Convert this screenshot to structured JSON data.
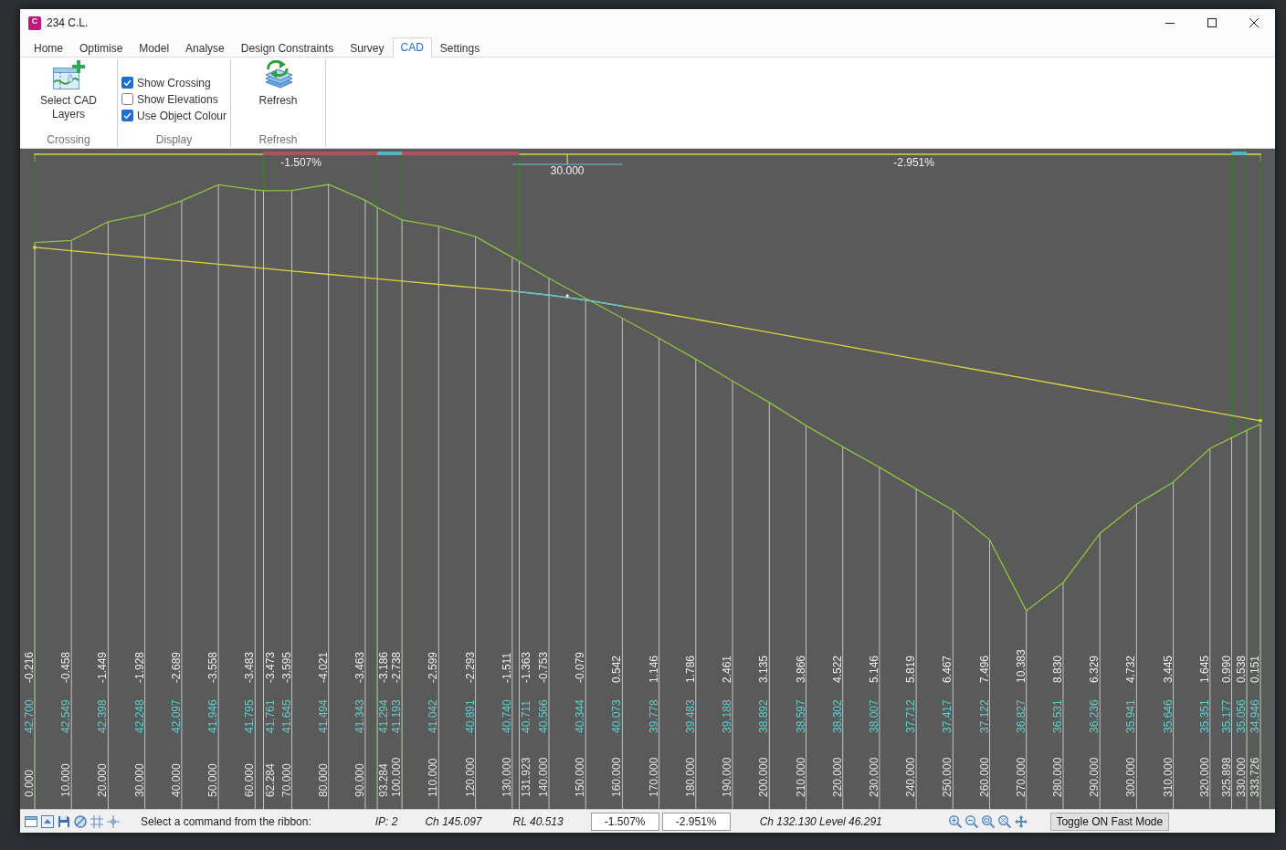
{
  "window": {
    "title": "234 C.L.",
    "logo_letter": "C"
  },
  "ribbon_tabs": [
    {
      "label": "Home",
      "selected": false
    },
    {
      "label": "Optimise",
      "selected": false
    },
    {
      "label": "Model",
      "selected": false
    },
    {
      "label": "Analyse",
      "selected": false
    },
    {
      "label": "Design Constraints",
      "selected": false
    },
    {
      "label": "Survey",
      "selected": false
    },
    {
      "label": "CAD",
      "selected": true
    },
    {
      "label": "Settings",
      "selected": false
    }
  ],
  "ribbon_groups": [
    {
      "kind": "layers",
      "label": "Crossing",
      "button": "Select CAD Layers"
    },
    {
      "kind": "checkboxes",
      "label": "Display",
      "checkboxes": [
        {
          "label": "Show Crossing",
          "checked": true
        },
        {
          "label": "Show Elevations",
          "checked": false
        },
        {
          "label": "Use Object Colour",
          "checked": true
        }
      ]
    },
    {
      "kind": "refresh",
      "label": "Refresh",
      "button": "Refresh"
    }
  ],
  "long_section": {
    "grades": [
      {
        "label": "-1.507%"
      },
      {
        "label": "-2.951%"
      }
    ],
    "vertical_curve": {
      "length": "30.000"
    },
    "alignment_segments": [
      {
        "kind": "plain"
      },
      {
        "kind": "band",
        "color": "#b4505c"
      },
      {
        "kind": "band",
        "color": "#4db8cc"
      },
      {
        "kind": "band",
        "color": "#b4505c"
      },
      {
        "kind": "plain"
      },
      {
        "kind": "band",
        "color": "#4db8cc"
      },
      {
        "kind": "plain"
      }
    ],
    "stations": [
      {
        "kind": "key",
        "chainage": "0.000",
        "level": "42.700",
        "depth": "-0.216"
      },
      {
        "kind": "regular",
        "chainage": "10.000",
        "level": "42.549",
        "depth": "-0.458"
      },
      {
        "kind": "regular",
        "chainage": "20.000",
        "level": "42.398",
        "depth": "-1.449"
      },
      {
        "kind": "regular",
        "chainage": "30.000",
        "level": "42.248",
        "depth": "-1.928"
      },
      {
        "kind": "regular",
        "chainage": "40.000",
        "level": "42.097",
        "depth": "-2.689"
      },
      {
        "kind": "regular",
        "chainage": "50.000",
        "level": "41.946",
        "depth": "-3.558"
      },
      {
        "kind": "regular",
        "chainage": "60.000",
        "level": "41.795",
        "depth": "-3.483"
      },
      {
        "kind": "key",
        "chainage": "62.284",
        "level": "41.761",
        "depth": "-3.473"
      },
      {
        "kind": "regular",
        "chainage": "70.000",
        "level": "41.645",
        "depth": "-3.595"
      },
      {
        "kind": "regular",
        "chainage": "80.000",
        "level": "41.494",
        "depth": "-4.021"
      },
      {
        "kind": "regular",
        "chainage": "90.000",
        "level": "41.343",
        "depth": "-3.463"
      },
      {
        "kind": "key",
        "chainage": "93.284",
        "level": "41.294",
        "depth": "-3.186"
      },
      {
        "kind": "key",
        "chainage": "100.000",
        "level": "41.193",
        "depth": "-2.738"
      },
      {
        "kind": "regular",
        "chainage": "110.000",
        "level": "41.042",
        "depth": "-2.599"
      },
      {
        "kind": "regular",
        "chainage": "120.000",
        "level": "40.891",
        "depth": "-2.293"
      },
      {
        "kind": "regular",
        "chainage": "130.000",
        "level": "40.740",
        "depth": "-1.511"
      },
      {
        "kind": "key",
        "chainage": "131.923",
        "level": "40.711",
        "depth": "-1.363"
      },
      {
        "kind": "regular",
        "chainage": "140.000",
        "level": "40.566",
        "depth": "-0.753"
      },
      {
        "kind": "regular",
        "chainage": "150.000",
        "level": "40.344",
        "depth": "-0.079"
      },
      {
        "kind": "regular",
        "chainage": "160.000",
        "level": "40.073",
        "depth": "0.542"
      },
      {
        "kind": "regular",
        "chainage": "170.000",
        "level": "39.778",
        "depth": "1.146"
      },
      {
        "kind": "regular",
        "chainage": "180.000",
        "level": "39.483",
        "depth": "1.786"
      },
      {
        "kind": "regular",
        "chainage": "190.000",
        "level": "39.188",
        "depth": "2.461"
      },
      {
        "kind": "regular",
        "chainage": "200.000",
        "level": "38.892",
        "depth": "3.135"
      },
      {
        "kind": "regular",
        "chainage": "210.000",
        "level": "38.597",
        "depth": "3.866"
      },
      {
        "kind": "regular",
        "chainage": "220.000",
        "level": "38.302",
        "depth": "4.522"
      },
      {
        "kind": "regular",
        "chainage": "230.000",
        "level": "38.007",
        "depth": "5.146"
      },
      {
        "kind": "regular",
        "chainage": "240.000",
        "level": "37.712",
        "depth": "5.819"
      },
      {
        "kind": "regular",
        "chainage": "250.000",
        "level": "37.417",
        "depth": "6.467"
      },
      {
        "kind": "regular",
        "chainage": "260.000",
        "level": "37.122",
        "depth": "7.496"
      },
      {
        "kind": "regular",
        "chainage": "270.000",
        "level": "36.827",
        "depth": "10.383"
      },
      {
        "kind": "regular",
        "chainage": "280.000",
        "level": "36.531",
        "depth": "8.830"
      },
      {
        "kind": "regular",
        "chainage": "290.000",
        "level": "36.236",
        "depth": "6.329"
      },
      {
        "kind": "regular",
        "chainage": "300.000",
        "level": "35.941",
        "depth": "4.732"
      },
      {
        "kind": "regular",
        "chainage": "310.000",
        "level": "35.646",
        "depth": "3.445"
      },
      {
        "kind": "regular",
        "chainage": "320.000",
        "level": "35.351",
        "depth": "1.645"
      },
      {
        "kind": "key",
        "chainage": "325.898",
        "level": "35.177",
        "depth": "0.990"
      },
      {
        "kind": "key",
        "chainage": "330.000",
        "level": "35.056",
        "depth": "0.538"
      },
      {
        "kind": "key",
        "chainage": "333.726",
        "level": "34.946",
        "depth": "0.151"
      }
    ]
  },
  "status_bar": {
    "prompt": "Select a command from the ribbon:",
    "ip": "IP: 2",
    "chainage": "Ch 145.097",
    "level": "RL 40.513",
    "grade_fields": [
      {
        "value": "-1.507%"
      },
      {
        "value": "-2.951%"
      }
    ],
    "cursor": "Ch 132.130 Level 46.291",
    "button": "Toggle ON Fast Mode"
  }
}
